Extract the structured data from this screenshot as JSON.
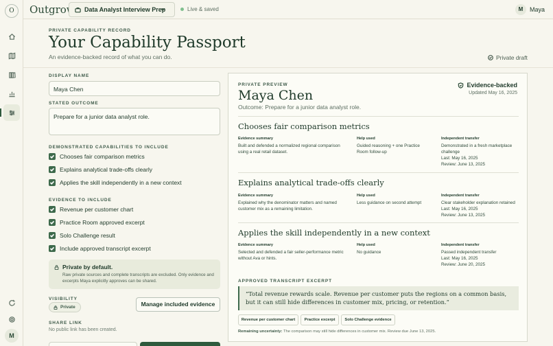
{
  "app": {
    "logo_letter": "O",
    "brand": "Outgrow",
    "user_initial": "M",
    "user_name": "Maya"
  },
  "workspace": {
    "name": "Data Analyst Interview Prep",
    "status": "Live & saved"
  },
  "page": {
    "eyebrow": "PRIVATE CAPABILITY RECORD",
    "title": "Your Capability Passport",
    "subtitle": "An evidence-backed record of what you can do.",
    "draft_label": "Private draft"
  },
  "form": {
    "display_name_label": "DISPLAY NAME",
    "display_name_value": "Maya Chen",
    "outcome_label": "STATED OUTCOME",
    "outcome_value": "Prepare for a junior data analyst role.",
    "capabilities_label": "DEMONSTRATED CAPABILITIES TO INCLUDE",
    "capabilities": [
      "Chooses fair comparison metrics",
      "Explains analytical trade-offs clearly",
      "Applies the skill independently in a new context"
    ],
    "evidence_label": "EVIDENCE TO INCLUDE",
    "evidence": [
      "Revenue per customer chart",
      "Practice Room approved excerpt",
      "Solo Challenge result",
      "Include approved transcript excerpt"
    ],
    "privacy_title": "Private by default.",
    "privacy_body": "Raw private sources and complete transcripts are excluded. Only evidence and excerpts Maya explicitly approves can be shared.",
    "visibility_label": "VISIBILITY",
    "visibility_value": "Private",
    "manage_button": "Manage included evidence",
    "share_label": "SHARE LINK",
    "share_value": "No public link has been created."
  },
  "preview": {
    "eyebrow": "PRIVATE PREVIEW",
    "name": "Maya Chen",
    "outcome": "Outcome: Prepare for a junior data analyst role.",
    "badge": "Evidence-backed",
    "updated": "Updated May 16, 2025",
    "col_summary": "Evidence summary",
    "col_help": "Help used",
    "col_transfer": "Independent transfer",
    "capabilities": [
      {
        "title": "Chooses fair comparison metrics",
        "summary": "Built and defended a normalized regional comparison using a real retail dataset.",
        "help": "Guided reasoning + one Practice Room follow-up",
        "transfer": "Demonstrated in a fresh marketplace challenge",
        "last": "Last: May 16, 2025",
        "review": "Review: June 13, 2025"
      },
      {
        "title": "Explains analytical trade-offs clearly",
        "summary": "Explained why the denominator matters and named customer mix as a remaining limitation.",
        "help": "Less guidance on second attempt",
        "transfer": "Clear stakeholder explanation retained",
        "last": "Last: May 16, 2025",
        "review": "Review: June 13, 2025"
      },
      {
        "title": "Applies the skill independently in a new context",
        "summary": "Selected and defended a fair seller-performance metric without Ava or hints.",
        "help": "No guidance",
        "transfer": "Passed independent transfer",
        "last": "Last: May 16, 2025",
        "review": "Review: June 20, 2025"
      }
    ],
    "transcript_label": "APPROVED TRANSCRIPT EXCERPT",
    "quote": "“Total revenue rewards scale. Revenue per customer puts the regions on a common basis, but it can still hide differences in customer mix, pricing, or retention.”",
    "chips": [
      "Revenue per customer chart",
      "Practice excerpt",
      "Solo Challenge evidence"
    ],
    "remaining_label": "Remaining uncertainty:",
    "remaining_text": "The comparison may still hide differences in customer mix. Review due June 13, 2025."
  }
}
